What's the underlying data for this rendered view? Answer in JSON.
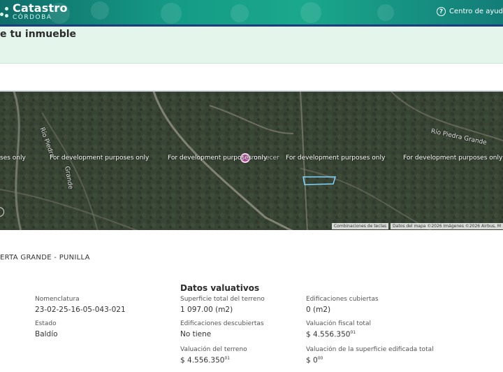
{
  "header": {
    "logo_title": "Catastro",
    "logo_subtitle": "CÓRDOBA",
    "help_label": "Centro de ayud",
    "help_icon": "question-circle-icon"
  },
  "page": {
    "title": "e tu inmueble"
  },
  "map": {
    "watermarks": [
      "ses only",
      "For development purposes only",
      "For development purposes only",
      "For development purposes only",
      "For development purposes only"
    ],
    "river_labels": [
      "Río Piedra",
      "Grande",
      "Río Piedra Grande"
    ],
    "place_label": "manecer",
    "attribution": [
      "Combinaciones de teclas",
      "Datos del mapa ©2026 Imágenes ©2026 Airbus, M"
    ]
  },
  "location": "ERTA GRANDE - PUNILLA",
  "valuation": {
    "title": "Datos valuativos"
  },
  "fields": {
    "nomenclatura": {
      "label": "Nomenclatura",
      "value": "23-02-25-16-05-043-021"
    },
    "estado": {
      "label": "Estado",
      "value": "Baldío"
    },
    "superficie": {
      "label": "Superficie total del terreno",
      "value": "1 097.00 (m2)"
    },
    "edif_descubiertas": {
      "label": "Edificaciones descubiertas",
      "value": "No tiene"
    },
    "val_terreno": {
      "label": "Valuación del terreno",
      "value": "$ 4.556.350",
      "cents": "01"
    },
    "edif_cubiertas": {
      "label": "Edificaciones cubiertas",
      "value": "0 (m2)"
    },
    "val_fiscal": {
      "label": "Valuación fiscal total",
      "value": "$ 4.556.350",
      "cents": "01"
    },
    "val_edificada": {
      "label": "Valuación de la superficie edificada total",
      "value": "$ 0",
      "cents": "00"
    }
  }
}
